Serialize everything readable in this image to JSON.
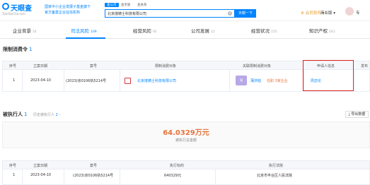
{
  "header": {
    "logo_text": "天眼查",
    "logo_sub": "TianYanCha.com",
    "slogan_line1": "国家中小企业发展子基金旗下",
    "slogan_line2": "官方备案企业征信机构",
    "search_tabs": [
      "查公司",
      "查老板",
      "查关系"
    ],
    "search_value": "北京撞铸士科技有限公司",
    "search_button": "天眼一下",
    "vip_label": "会员服务",
    "business_label": "商业版",
    "pro_label": "专"
  },
  "tabs": [
    {
      "label": "企业背景",
      "count": "54"
    },
    {
      "label": "司法风险",
      "count": "109"
    },
    {
      "label": "经营风险",
      "count": "92"
    },
    {
      "label": "公司发展",
      "count": "12"
    },
    {
      "label": "经营状况",
      "count": "155"
    },
    {
      "label": "知识产权",
      "count": "243"
    }
  ],
  "section1": {
    "title": "限制消费令",
    "count": "1",
    "columns": [
      "序号",
      "立案日期",
      "案号",
      "限制消费对象",
      "关联限制消费对象",
      "申请人信息",
      "发布"
    ],
    "rows": [
      {
        "index": "1",
        "date": "2023-04-10",
        "case_no": "(2023)京0106执5214号",
        "company": "北京撞铸士科技有限公司",
        "person_tag": "蒲",
        "person": "蒲洪柏",
        "person_role": "任职 3家企业",
        "applicant": "周志伦"
      }
    ]
  },
  "section2": {
    "title": "被执行人",
    "count": "1",
    "hint": "历史被执行人",
    "hint_count": "2",
    "export_label": "导出数据",
    "amount": "64.0329万元",
    "amount_label": "被执行总金额",
    "columns": [
      "序号",
      "立案日期",
      "案号",
      "执行标的",
      "执行法院"
    ],
    "rows": [
      {
        "index": "1",
        "date": "2023-04-10",
        "case_no": "(2023)京0106执5214号",
        "target": "640329元",
        "court": "北京市丰台区人民法院"
      }
    ]
  }
}
